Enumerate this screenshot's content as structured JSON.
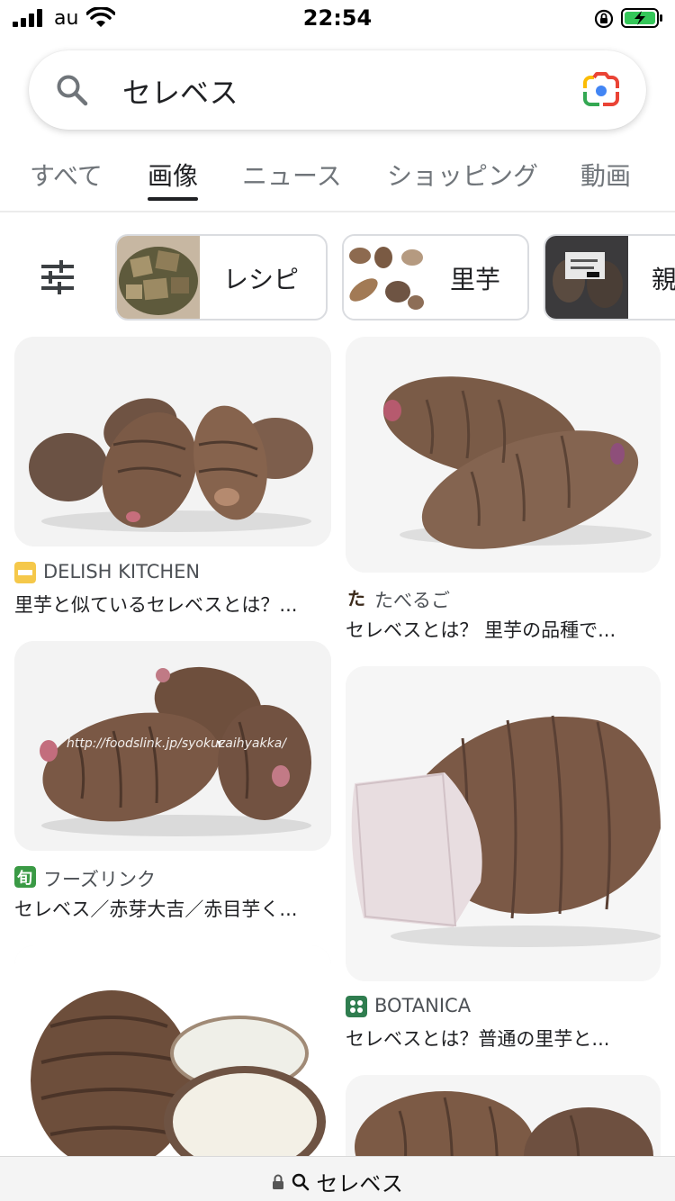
{
  "status_bar": {
    "carrier": "au",
    "time": "22:54"
  },
  "search": {
    "query": "セレベス"
  },
  "tabs": [
    {
      "label": "すべて"
    },
    {
      "label": "画像"
    },
    {
      "label": "ニュース"
    },
    {
      "label": "ショッピング"
    },
    {
      "label": "動画"
    }
  ],
  "chips": [
    {
      "label": "レシピ"
    },
    {
      "label": "里芋"
    },
    {
      "label": "親"
    }
  ],
  "results": [
    {
      "source": "DELISH KITCHEN",
      "title": "里芋と似ているセレベスとは？..."
    },
    {
      "source": "たべるご",
      "title": "セレベスとは？ 里芋の品種で..."
    },
    {
      "source": "フーズリンク",
      "title": "セレベス／赤芽大吉／赤目芋く..."
    },
    {
      "source": "BOTANICA",
      "title": "セレベスとは？普通の里芋と..."
    }
  ],
  "watermark": "http://foodslink.jp/syokuzaihyakka/",
  "url_bar": {
    "text": "セレベス"
  },
  "colors": {
    "accent": "#202124",
    "muted": "#70757a",
    "battery_green": "#34c759"
  }
}
